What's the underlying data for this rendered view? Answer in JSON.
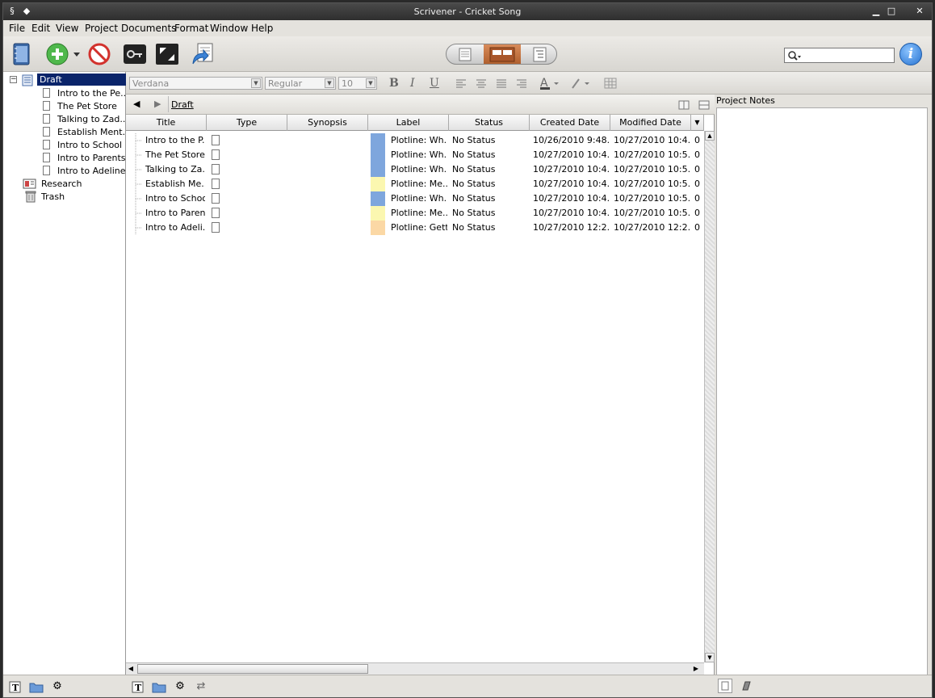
{
  "window": {
    "title": "Scrivener - Cricket Song"
  },
  "menu": [
    "File",
    "Edit",
    "View",
    "Project",
    "Documents",
    "Format",
    "Window",
    "Help"
  ],
  "icons": {
    "binder": "binder-icon",
    "add": "add-icon",
    "delete": "delete-icon",
    "keywords": "key-icon",
    "fullscreen": "fullscreen-icon",
    "compile": "compile-icon",
    "search": "search-icon",
    "info": "info-icon"
  },
  "binder": {
    "draft": "Draft",
    "documents": [
      "Intro to the Pe...",
      "The Pet Store",
      "Talking to Zad...",
      "Establish Ment...",
      "Intro to School",
      "Intro to Parents",
      "Intro to Adeline..."
    ],
    "research": "Research",
    "trash": "Trash"
  },
  "format_bar": {
    "font": "Verdana",
    "style": "Regular",
    "size": "10"
  },
  "editor": {
    "breadcrumb": "Draft",
    "columns": [
      "Title",
      "Type",
      "Synopsis",
      "Label",
      "Status",
      "Created Date",
      "Modified Date"
    ],
    "rows": [
      {
        "title": "Intro to the P...",
        "label": "Plotline: Wh...",
        "label_color": "#7ea6dd",
        "status": "No Status",
        "created": "10/26/2010 9:48...",
        "modified": "10/27/2010 10:4...",
        "extra": "0"
      },
      {
        "title": "The Pet Store",
        "label": "Plotline: Wh...",
        "label_color": "#7ea6dd",
        "status": "No Status",
        "created": "10/27/2010 10:4...",
        "modified": "10/27/2010 10:5...",
        "extra": "0"
      },
      {
        "title": "Talking to Za...",
        "label": "Plotline: Wh...",
        "label_color": "#7ea6dd",
        "status": "No Status",
        "created": "10/27/2010 10:4...",
        "modified": "10/27/2010 10:5...",
        "extra": "0"
      },
      {
        "title": "Establish Me...",
        "label": "Plotline: Me...",
        "label_color": "#fbf7b0",
        "status": "No Status",
        "created": "10/27/2010 10:4...",
        "modified": "10/27/2010 10:5...",
        "extra": "0"
      },
      {
        "title": "Intro to School",
        "label": "Plotline: Wh...",
        "label_color": "#7ea6dd",
        "status": "No Status",
        "created": "10/27/2010 10:4...",
        "modified": "10/27/2010 10:5...",
        "extra": "0"
      },
      {
        "title": "Intro to Parents",
        "label": "Plotline: Me...",
        "label_color": "#fbf7b0",
        "status": "No Status",
        "created": "10/27/2010 10:4...",
        "modified": "10/27/2010 10:5...",
        "extra": "0"
      },
      {
        "title": "Intro to Adeli...",
        "label": "Plotline: Gett...",
        "label_color": "#fbd8a5",
        "status": "No Status",
        "created": "10/27/2010 12:2...",
        "modified": "10/27/2010 12:2...",
        "extra": "0"
      }
    ]
  },
  "inspector": {
    "header": "Project Notes"
  }
}
